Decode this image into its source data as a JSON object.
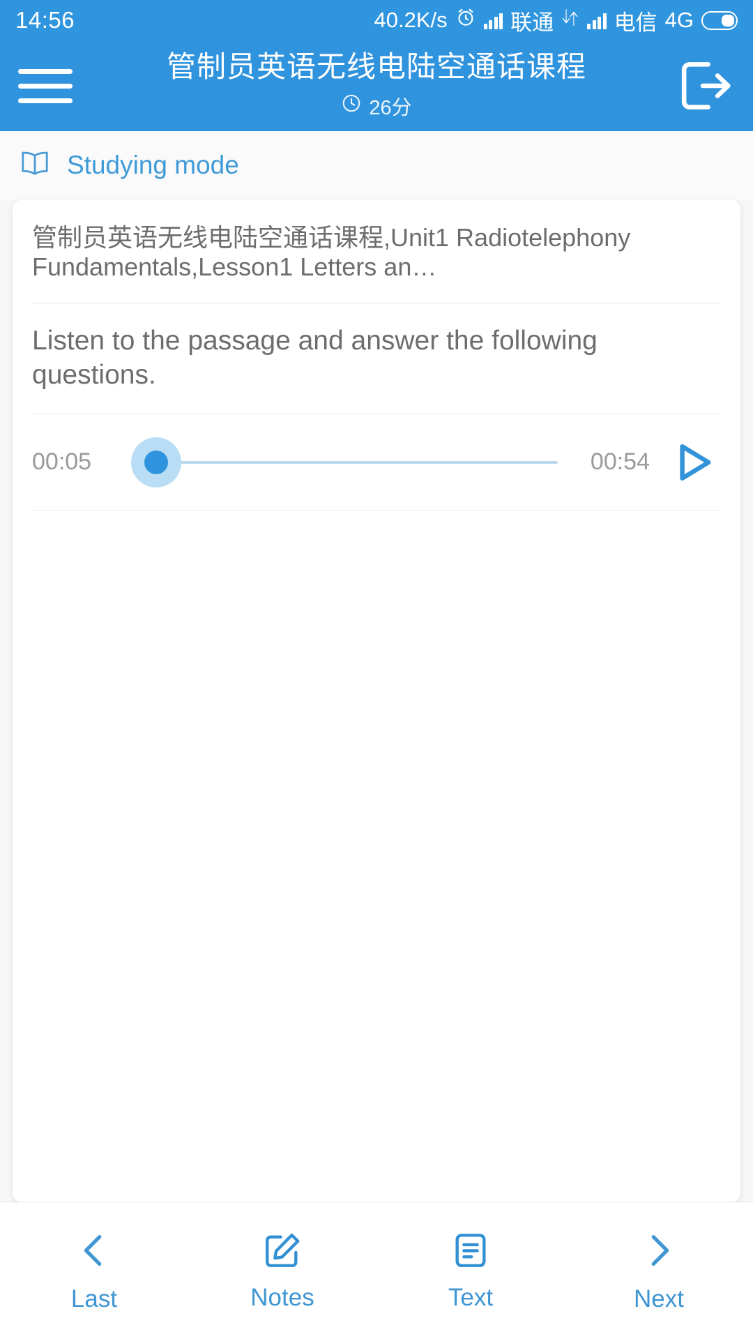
{
  "status_bar": {
    "time": "14:56",
    "net_speed": "40.2K/s",
    "alarm_icon": "alarm-clock-icon",
    "signal_icon_1": "signal-bars-icon",
    "carrier_1": "联通",
    "data_transfer_icon": "data-transfer-icon",
    "signal_icon_2": "signal-bars-icon",
    "carrier_2": "电信",
    "network_type": "4G",
    "battery_icon": "battery-icon"
  },
  "app_bar": {
    "menu_icon": "hamburger-menu-icon",
    "title": "管制员英语无线电陆空通话课程",
    "duration_icon": "clock-icon",
    "duration": "26分",
    "exit_icon": "exit-icon",
    "background_color": "#3093de"
  },
  "mode_bar": {
    "icon": "open-book-icon",
    "label": "Studying mode",
    "color": "#3f9ad8"
  },
  "lesson": {
    "breadcrumb": "管制员英语无线电陆空通话课程,Unit1 Radiotelephony Fundamentals,Lesson1 Letters an…",
    "question": "Listen to the passage and answer the following questions."
  },
  "audio": {
    "current_time": "00:05",
    "total_time": "00:54",
    "progress_percent": 5.5,
    "play_icon": "play-icon",
    "thumb_color": "#2f93dd",
    "track_color": "#b9d9ef"
  },
  "bottom_nav": {
    "items": [
      {
        "label": "Last",
        "icon": "chevron-left-icon"
      },
      {
        "label": "Notes",
        "icon": "edit-note-icon"
      },
      {
        "label": "Text",
        "icon": "document-text-icon"
      },
      {
        "label": "Next",
        "icon": "chevron-right-icon"
      }
    ],
    "color": "#3f96d2"
  }
}
